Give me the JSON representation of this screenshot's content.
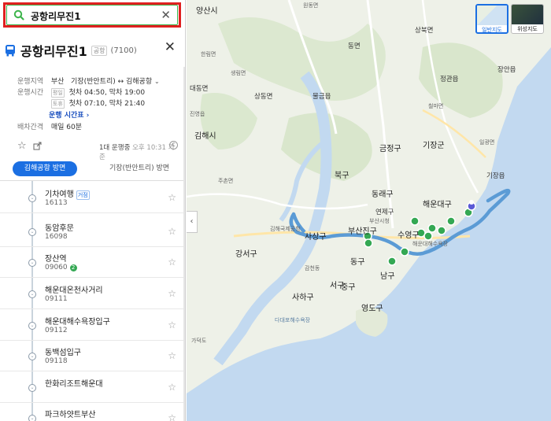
{
  "search": {
    "value": "공항리무진1"
  },
  "route": {
    "name": "공항리무진1",
    "type_tag": "공항",
    "code": "(7100)"
  },
  "info": {
    "area_label": "운행지역",
    "area_from": "부산",
    "area_to_text": "기장(반안트리) ↔ 김해공항",
    "hours_label": "운행시간",
    "weekday_tag": "평일",
    "weekday_hours": "첫차 04:50, 막차 19:00",
    "weekend_tag": "토휴",
    "weekend_hours": "첫차 07:10, 막차 21:40",
    "timetable_link": "운행 시간표",
    "interval_label": "배차간격",
    "interval_value": "매일 60분"
  },
  "status": {
    "running": "1대 운행중",
    "time": "오후 10:31 기준",
    "refresh": "C"
  },
  "tabs": [
    {
      "label": "김해공항 방면"
    },
    {
      "label": "기장(반안트리) 방면"
    }
  ],
  "stops": [
    {
      "name": "기차여행",
      "id": "16113",
      "badge": "거점"
    },
    {
      "name": "동암후문",
      "id": "16098"
    },
    {
      "name": "장산역",
      "id": "09060",
      "badge_num": "2"
    },
    {
      "name": "해운대온천사거리",
      "id": "09111"
    },
    {
      "name": "해운대해수욕장입구",
      "id": "09112"
    },
    {
      "name": "동백섬입구",
      "id": "09118"
    },
    {
      "name": "한화리조트해운대",
      "id": ""
    },
    {
      "name": "파크하얏트부산",
      "id": ""
    }
  ],
  "map": {
    "map_types": [
      {
        "label": "일반지도"
      },
      {
        "label": "위성지도"
      }
    ],
    "labels": [
      "양산시",
      "원동면",
      "동면",
      "상북면",
      "정관읍",
      "장안읍",
      "대동면",
      "상동면",
      "물금읍",
      "김해시",
      "기장군",
      "금정구",
      "북구",
      "동래구",
      "해운대구",
      "수영구",
      "부산진구",
      "연제구",
      "사상구",
      "강서구",
      "남구",
      "동구",
      "서구",
      "중구",
      "사하구",
      "영도구",
      "가덕도",
      "김해국제공항",
      "해운대해수욕장",
      "철마면",
      "일광면",
      "기장읍",
      "한림면",
      "생림면",
      "진영읍",
      "주촌면",
      "부산시청",
      "감천동",
      "다대포해수욕장"
    ],
    "collapse_icon": "‹"
  },
  "colors": {
    "accent": "#1b6fe2",
    "route": "#5b9bd5",
    "search_border": "#3cb44b",
    "highlight": "#e02020",
    "stop_marker": "#34a853"
  }
}
